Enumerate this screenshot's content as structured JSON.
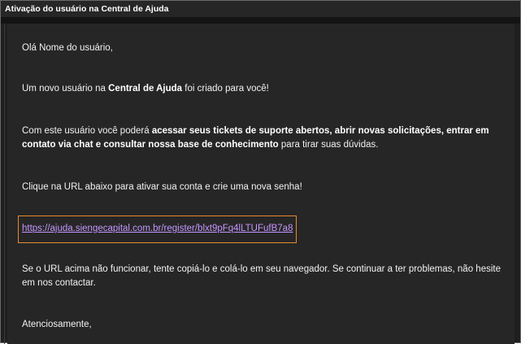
{
  "window": {
    "title": "Ativação do usuário na Central de Ajuda"
  },
  "email": {
    "greeting": "Olá Nome do usuário,",
    "p1": {
      "before": "Um novo usuário na ",
      "bold": "Central de Ajuda",
      "after": " foi criado para você!"
    },
    "p2": {
      "before": "Com este usuário você poderá ",
      "bold": "acessar seus tickets de suporte abertos, abrir novas solicitações, entrar em contato via chat e consultar nossa base de conhecimento",
      "after": " para tirar suas dúvidas."
    },
    "p3": "Clique na URL abaixo para ativar sua conta e crie uma nova senha!",
    "activation_link": "https://ajuda.siengecapital.com.br/register/blxt9pFq4lLTUFufB7a8",
    "p4": "Se o URL acima não funcionar, tente copiá-lo e colá-lo em seu navegador. Se continuar a ter problemas, não hesite em nos contactar.",
    "closing": "Atenciosamente,"
  },
  "colors": {
    "link": "#c596ff",
    "highlight_border": "#e88a2e",
    "background": "#262626"
  }
}
